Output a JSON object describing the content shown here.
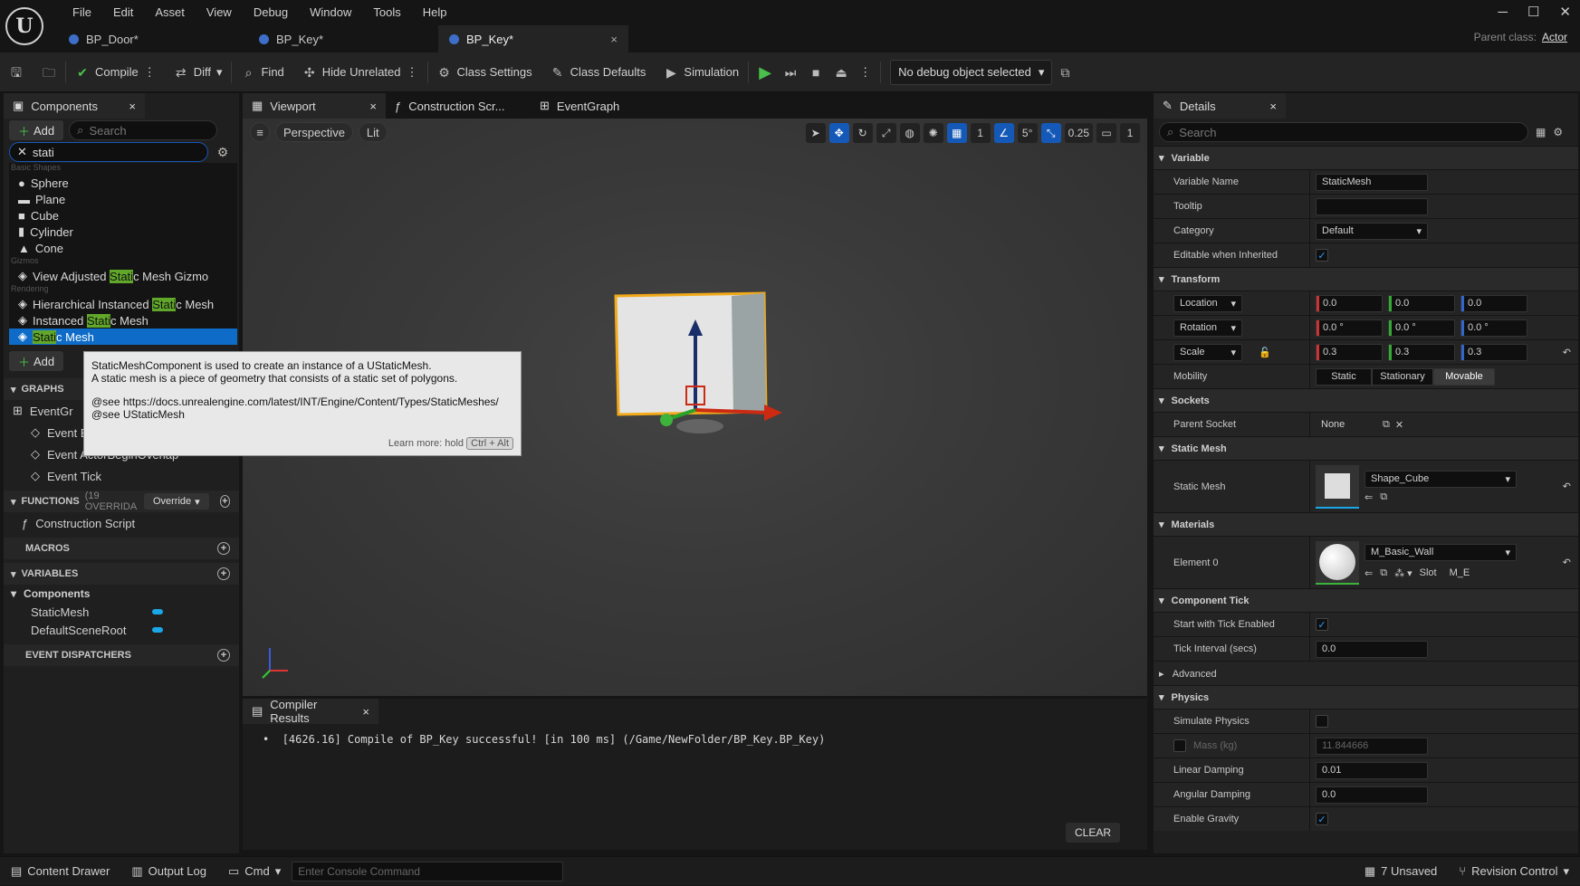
{
  "menu": [
    "File",
    "Edit",
    "Asset",
    "View",
    "Debug",
    "Window",
    "Tools",
    "Help"
  ],
  "tabs": [
    {
      "label": "BP_Door*"
    },
    {
      "label": "BP_Key*"
    },
    {
      "label": "BP_Key*",
      "close": "×"
    }
  ],
  "parent_class": {
    "label": "Parent class:",
    "value": "Actor"
  },
  "toolbar": {
    "compile": "Compile",
    "diff": "Diff",
    "find": "Find",
    "hide_unrelated": "Hide Unrelated",
    "class_settings": "Class Settings",
    "class_defaults": "Class Defaults",
    "simulation": "Simulation",
    "debug_object": "No debug object selected"
  },
  "components": {
    "tab": "Components",
    "add": "Add",
    "search_placeholder": "Search",
    "filter": "stati",
    "cat_basic": "Basic Shapes",
    "cat_gizmos": "Gizmos",
    "cat_rendering": "Rendering",
    "basic": [
      "Sphere",
      "Plane",
      "Cube",
      "Cylinder",
      "Cone"
    ],
    "gizmo": {
      "pre": "View Adjusted ",
      "hl": "Stati",
      "post": "c Mesh Gizmo"
    },
    "hism": {
      "pre": "Hierarchical Instanced ",
      "hl": "Stati",
      "post": "c Mesh"
    },
    "ism": {
      "pre": "Instanced ",
      "hl": "Stati",
      "post": "c Mesh"
    },
    "sm": {
      "pre": "",
      "hl": "Stati",
      "post": "c Mesh"
    }
  },
  "tooltip": {
    "line1": "StaticMeshComponent is used to create an instance of a UStaticMesh.",
    "line2": "A static mesh is a piece of geometry that consists of a static set of polygons.",
    "line3": "@see https://docs.unrealengine.com/latest/INT/Engine/Content/Types/StaticMeshes/",
    "line4": "@see UStaticMesh",
    "learn": "Learn more: hold",
    "keys": "Ctrl + Alt"
  },
  "mybp": {
    "add": "Add",
    "graphs": "GRAPHS",
    "eventgraph": "EventGr",
    "events": [
      "Event BeginPlay",
      "Event ActorBeginOverlap",
      "Event Tick"
    ],
    "functions": "FUNCTIONS",
    "functions_note": "(19 OVERRIDA",
    "override": "Override",
    "construction": "Construction Script",
    "macros": "MACROS",
    "variables": "VARIABLES",
    "components_cat": "Components",
    "vars": [
      "StaticMesh",
      "DefaultSceneRoot"
    ],
    "dispatchers": "EVENT DISPATCHERS"
  },
  "center_tabs": [
    "Viewport",
    "Construction Scr...",
    "EventGraph"
  ],
  "viewport": {
    "perspective": "Perspective",
    "lit": "Lit",
    "grid": "1",
    "angle": "5°",
    "scale": "0.25",
    "cam": "1"
  },
  "compiler": {
    "tab": "Compiler Results",
    "message": "[4626.16] Compile of BP_Key successful! [in 100 ms] (/Game/NewFolder/BP_Key.BP_Key)",
    "clear": "CLEAR"
  },
  "details": {
    "tab": "Details",
    "search_placeholder": "Search",
    "variable": "Variable",
    "variable_name": "Variable Name",
    "variable_name_val": "StaticMesh",
    "tooltip": "Tooltip",
    "category": "Category",
    "category_val": "Default",
    "editable": "Editable when Inherited",
    "transform": "Transform",
    "location": "Location",
    "rotation": "Rotation",
    "scale": "Scale",
    "loc": [
      "0.0",
      "0.0",
      "0.0"
    ],
    "rot": [
      "0.0 °",
      "0.0 °",
      "0.0 °"
    ],
    "scl": [
      "0.3",
      "0.3",
      "0.3"
    ],
    "mobility": "Mobility",
    "mob_opts": [
      "Static",
      "Stationary",
      "Movable"
    ],
    "sockets": "Sockets",
    "parent_socket": "Parent Socket",
    "parent_socket_val": "None",
    "static_mesh_sec": "Static Mesh",
    "static_mesh": "Static Mesh",
    "static_mesh_val": "Shape_Cube",
    "materials": "Materials",
    "element0": "Element 0",
    "material_val": "M_Basic_Wall",
    "slot": "Slot",
    "slot_val": "M_E",
    "component_tick": "Component Tick",
    "start_tick": "Start with Tick Enabled",
    "tick_interval": "Tick Interval (secs)",
    "tick_interval_val": "0.0",
    "advanced": "Advanced",
    "physics": "Physics",
    "simulate": "Simulate Physics",
    "mass": "Mass (kg)",
    "mass_val": "11.844666",
    "linear": "Linear Damping",
    "linear_val": "0.01",
    "angular": "Angular Damping",
    "angular_val": "0.0",
    "gravity": "Enable Gravity"
  },
  "status": {
    "content_drawer": "Content Drawer",
    "output_log": "Output Log",
    "cmd": "Cmd",
    "console_placeholder": "Enter Console Command",
    "unsaved": "7 Unsaved",
    "revision": "Revision Control"
  },
  "colors": {
    "accent": "#0e6cc8",
    "highlight": "#61a82a",
    "play": "#49c04a"
  }
}
